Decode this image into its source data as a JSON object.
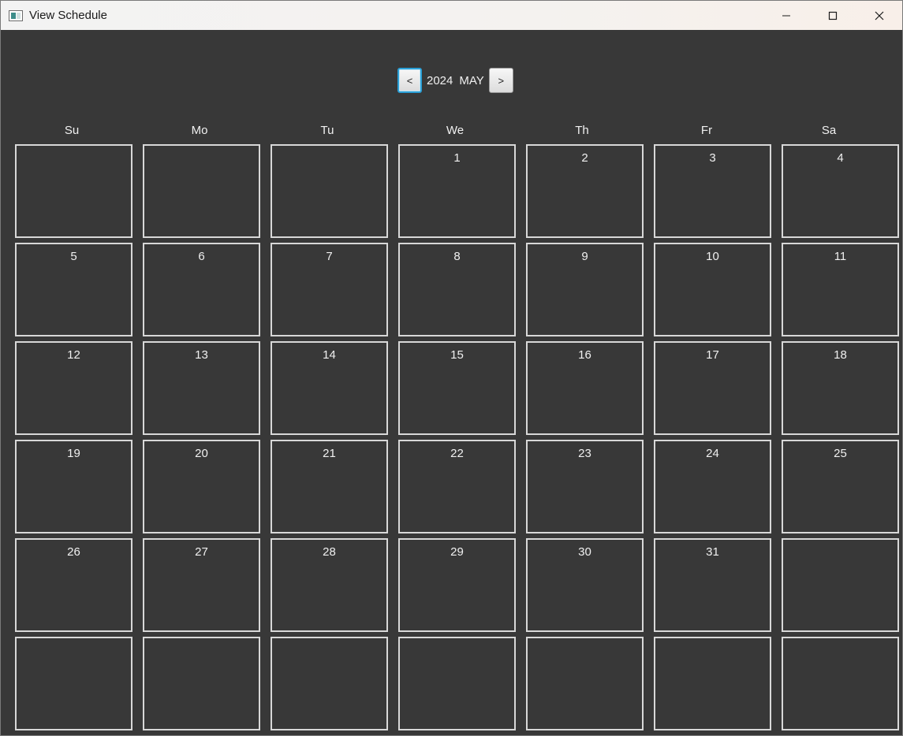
{
  "window": {
    "title": "View Schedule",
    "icon": "app-window-icon",
    "controls": [
      "minimize-icon",
      "maximize-icon",
      "close-icon"
    ]
  },
  "nav": {
    "prev_label": "<",
    "next_label": ">",
    "year": "2024",
    "month": "MAY"
  },
  "days_of_week": [
    "Su",
    "Mo",
    "Tu",
    "We",
    "Th",
    "Fr",
    "Sa"
  ],
  "weeks": [
    [
      "",
      "",
      "",
      "1",
      "2",
      "3",
      "4"
    ],
    [
      "5",
      "6",
      "7",
      "8",
      "9",
      "10",
      "11"
    ],
    [
      "12",
      "13",
      "14",
      "15",
      "16",
      "17",
      "18"
    ],
    [
      "19",
      "20",
      "21",
      "22",
      "23",
      "24",
      "25"
    ],
    [
      "26",
      "27",
      "28",
      "29",
      "30",
      "31",
      ""
    ],
    [
      "",
      "",
      "",
      "",
      "",
      "",
      ""
    ]
  ],
  "colors": {
    "background": "#383838",
    "cell_border": "#d8d8d8",
    "focus": "#2a9fd6"
  }
}
